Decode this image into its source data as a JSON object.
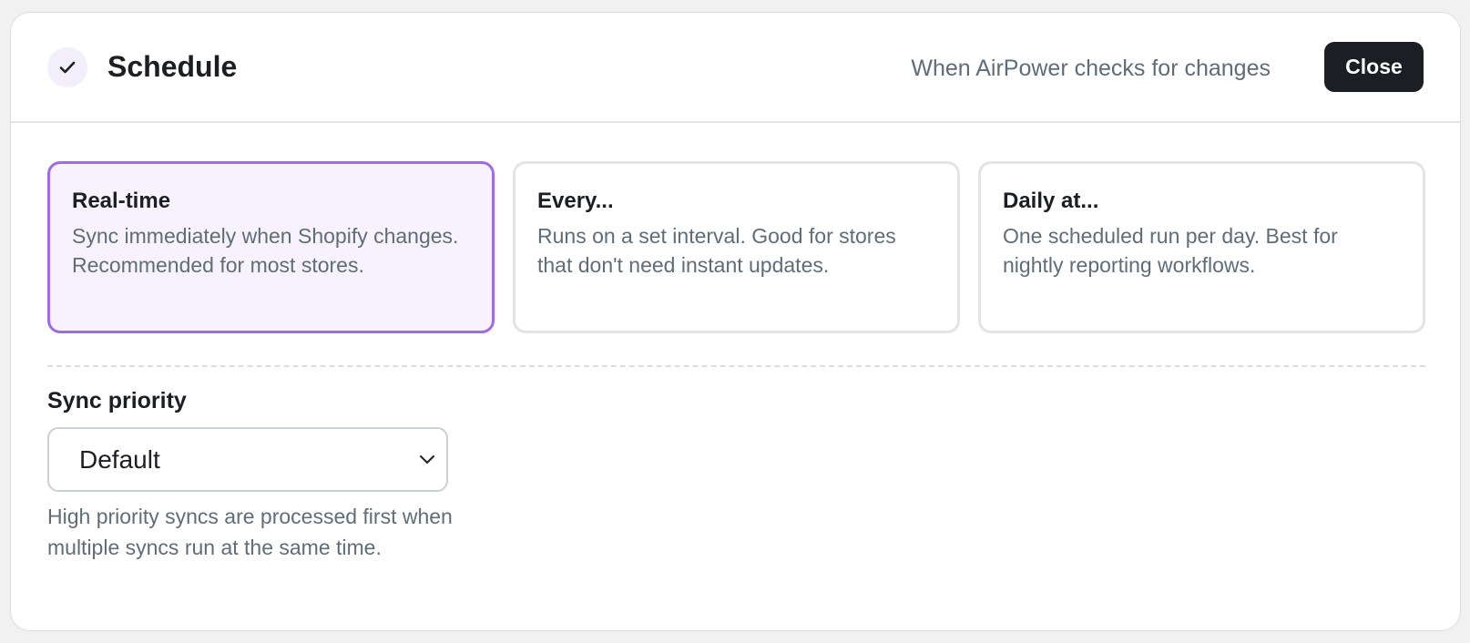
{
  "header": {
    "title": "Schedule",
    "subtitle": "When AirPower checks for changes",
    "close_label": "Close",
    "step_icon": "check-icon"
  },
  "schedule_options": [
    {
      "title": "Real-time",
      "description": "Sync immediately when Shopify changes. Recommended for most stores.",
      "selected": true
    },
    {
      "title": "Every...",
      "description": "Runs on a set interval. Good for stores that don't need instant updates.",
      "selected": false
    },
    {
      "title": "Daily at...",
      "description": "One scheduled run per day. Best for nightly reporting workflows.",
      "selected": false
    }
  ],
  "priority": {
    "label": "Sync priority",
    "selected_value": "Default",
    "help_text": "High priority syncs are processed first when multiple syncs run at the same time."
  },
  "colors": {
    "accent": "#9b6ce6",
    "selected_background": "#f7f2fd",
    "primary_button": "#1b1f24",
    "muted_text": "#5f6d79"
  }
}
